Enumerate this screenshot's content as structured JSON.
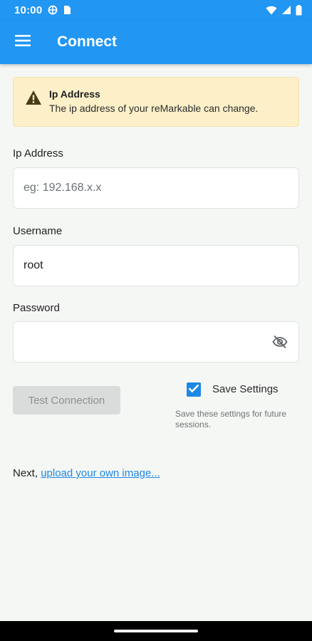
{
  "status_bar": {
    "time": "10:00",
    "icons": [
      "vpn-icon",
      "sim-card-icon",
      "wifi-icon",
      "signal-icon",
      "battery-icon"
    ]
  },
  "app_bar": {
    "title": "Connect",
    "menu_icon": "hamburger-menu-icon",
    "color": "#2196f3"
  },
  "banner": {
    "icon": "warning-icon",
    "title": "Ip Address",
    "text": "The ip address of your reMarkable can change.",
    "color": "#fdf0c9"
  },
  "form": {
    "ip": {
      "label": "Ip Address",
      "value": "",
      "placeholder": "eg: 192.168.x.x"
    },
    "username": {
      "label": "Username",
      "value": "root",
      "placeholder": ""
    },
    "password": {
      "label": "Password",
      "value": "",
      "placeholder": "",
      "toggle_icon": "visibility-off-icon"
    }
  },
  "actions": {
    "test_connection_label": "Test Connection",
    "save_settings": {
      "label": "Save Settings",
      "checked": true,
      "help": "Save these settings for future sessions."
    }
  },
  "footer": {
    "prefix": "Next, ",
    "link_text": "upload your own image..."
  }
}
